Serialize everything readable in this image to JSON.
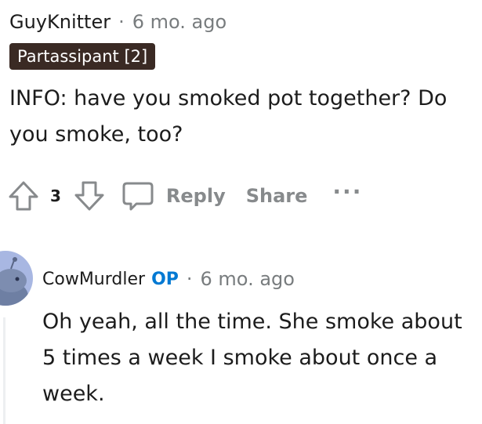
{
  "comment1": {
    "username": "GuyKnitter",
    "separator": "·",
    "time": "6 mo. ago",
    "flair": "Partassipant [2]",
    "body": "INFO: have you smoked pot together? Do you smoke, too?",
    "votes": "3",
    "reply_label": "Reply",
    "share_label": "Share",
    "more_label": "···"
  },
  "comment2": {
    "username": "CowMurdler",
    "op_badge": "OP",
    "separator": "·",
    "time": "6 mo. ago",
    "body": "Oh yeah, all the time. She smoke about 5 times a week I smoke about once a week."
  },
  "colors": {
    "flair_bg": "#3a2a24",
    "op_blue": "#0079d3",
    "muted": "#878a8c",
    "avatar_bg": "#a8b7e2"
  }
}
